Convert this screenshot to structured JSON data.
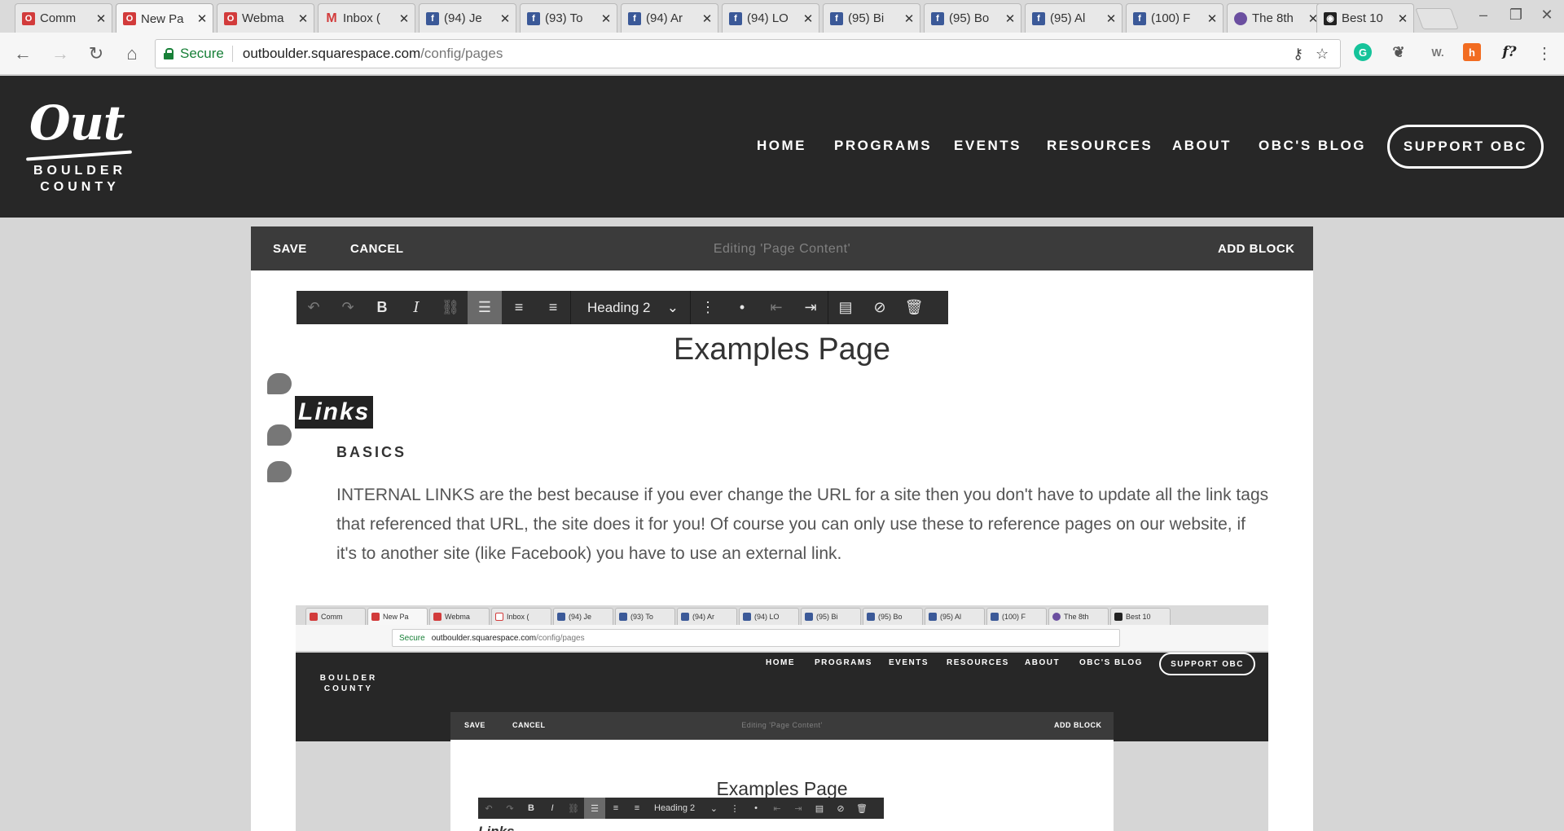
{
  "browser": {
    "tabs": [
      {
        "label": "Comm",
        "icon": "out-boulder-favicon"
      },
      {
        "label": "New Pa",
        "icon": "out-boulder-favicon",
        "active": true
      },
      {
        "label": "Webma",
        "icon": "out-boulder-favicon"
      },
      {
        "label": "Inbox (",
        "icon": "gmail-icon"
      },
      {
        "label": "(94) Je",
        "icon": "facebook-icon"
      },
      {
        "label": "(93) To",
        "icon": "facebook-icon"
      },
      {
        "label": "(94) Ar",
        "icon": "facebook-icon"
      },
      {
        "label": "(94) LO",
        "icon": "facebook-icon"
      },
      {
        "label": "(95) Bi",
        "icon": "facebook-icon"
      },
      {
        "label": "(95) Bo",
        "icon": "facebook-icon"
      },
      {
        "label": "(95) Al",
        "icon": "facebook-icon"
      },
      {
        "label": "(100) F",
        "icon": "facebook-icon"
      },
      {
        "label": "The 8th",
        "icon": "purple-circle-icon"
      },
      {
        "label": "Best 10",
        "icon": "camera-icon"
      }
    ],
    "secure_label": "Secure",
    "url_host": "outboulder.squarespace.com",
    "url_path": "/config/pages",
    "extensions": [
      "grammarly-icon",
      "evernote-icon",
      "wappalyzer-icon",
      "honey-icon",
      "formula-icon"
    ],
    "ext_labels": {
      "grammarly": "G",
      "wappalyzer": "W.",
      "honey": "h",
      "formula": "f?"
    }
  },
  "site": {
    "logo": {
      "script": "Out",
      "line1": "BOULDER",
      "line2": "COUNTY"
    },
    "nav": [
      "HOME",
      "PROGRAMS",
      "EVENTS",
      "RESOURCES",
      "ABOUT",
      "OBC'S BLOG"
    ],
    "support_label": "SUPPORT OBC"
  },
  "editor": {
    "save_label": "SAVE",
    "cancel_label": "CANCEL",
    "editing_title": "Editing 'Page Content'",
    "add_block_label": "ADD BLOCK",
    "heading_style": "Heading 2",
    "toolbar_buttons": [
      "undo-icon",
      "redo-icon",
      "bold-icon",
      "italic-icon",
      "link-icon",
      "align-left-icon",
      "align-center-icon",
      "align-right-icon",
      "numbered-list-icon",
      "bulleted-list-icon",
      "outdent-icon",
      "indent-icon",
      "paste-text-icon",
      "clear-format-icon",
      "delete-icon"
    ]
  },
  "content": {
    "page_title": "Examples Page",
    "links_heading": "Links",
    "basics_heading": "BASICS",
    "paragraph": "INTERNAL LINKS are the best because if you ever change the URL for a site then you don't have to update all the link tags that referenced that URL, the site does it for you! Of course you can only use these to reference pages on our website, if it's to another site (like Facebook) you have to use an external link."
  },
  "nested_screenshot": {
    "tabs": [
      "Comm",
      "New Pa",
      "Webma",
      "Inbox (",
      "(94) Je",
      "(93) To",
      "(94) Ar",
      "(94) LO",
      "(95) Bi",
      "(95) Bo",
      "(95) Al",
      "(100) F",
      "The 8th",
      "Best 10"
    ],
    "secure_label": "Secure",
    "url_host": "outboulder.squarespace.com",
    "url_path": "/config/pages",
    "nav": [
      "HOME",
      "PROGRAMS",
      "EVENTS",
      "RESOURCES",
      "ABOUT",
      "OBC'S BLOG"
    ],
    "support_label": "SUPPORT OBC",
    "logo_line1": "BOULDER",
    "logo_line2": "COUNTY",
    "save_label": "SAVE",
    "cancel_label": "CANCEL",
    "editing_title": "Editing 'Page Content'",
    "add_block_label": "ADD BLOCK",
    "page_title": "Examples Page",
    "heading_style": "Heading 2",
    "links_heading": "Links"
  },
  "colors": {
    "header_bg": "#272727",
    "editbar_bg": "#3b3b3b",
    "toolbar_bg": "#2e2e2e",
    "secure_green": "#188038",
    "facebook_blue": "#3b5998"
  }
}
